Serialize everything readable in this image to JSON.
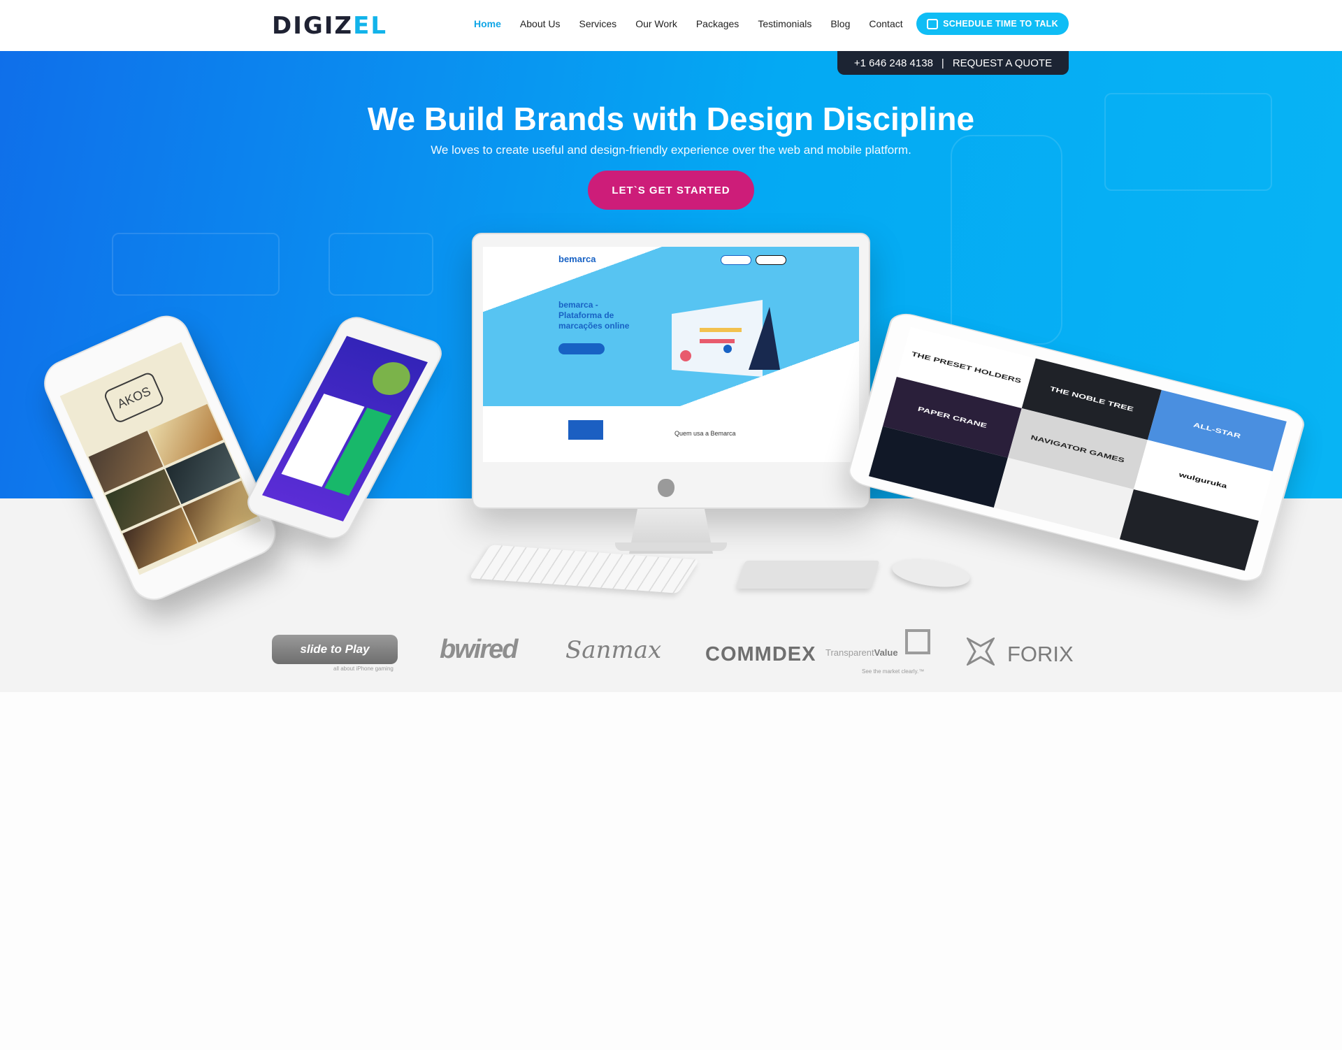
{
  "brand": {
    "name_main": "DIGIZ",
    "name_accent": "EL"
  },
  "nav": {
    "items": [
      {
        "label": "Home",
        "active": true
      },
      {
        "label": "About Us",
        "active": false
      },
      {
        "label": "Services",
        "active": false
      },
      {
        "label": "Our Work",
        "active": false
      },
      {
        "label": "Packages",
        "active": false
      },
      {
        "label": "Testimonials",
        "active": false
      },
      {
        "label": "Blog",
        "active": false
      },
      {
        "label": "Contact",
        "active": false
      }
    ],
    "cta_label": "SCHEDULE TIME TO TALK",
    "cta_icon": "calendar-icon"
  },
  "contact_bar": {
    "phone": "+1 646 248 4138",
    "separator": "|",
    "quote_label": "REQUEST A QUOTE"
  },
  "hero": {
    "title": "We Build Brands with Design Discipline",
    "subtitle": "We loves to create useful and design-friendly experience over the web and mobile platform.",
    "cta_label": "LET`S GET STARTED"
  },
  "imac_screen": {
    "logo": "bemarca",
    "headline": "bemarca - Plataforma de marcações online",
    "section_heading": "Quem usa a Bemarca"
  },
  "iphone_screen": {
    "logo": "AKOS"
  },
  "ipad_logos": [
    "THE PRESET HOLDERS",
    "THE NOBLE TREE",
    "ALL-STAR",
    "PAPER CRANE",
    "NAVIGATOR GAMES",
    "wulguruka"
  ],
  "client_logos": {
    "slide_to_play": "slide to Play",
    "slide_to_play_sub": "all about iPhone gaming",
    "bwired": "bwired",
    "sanmax": "Sanmax",
    "commdex": "COMMDEX",
    "transparent_value_a": "Transparent",
    "transparent_value_b": "Value",
    "transparent_value_sub": "See the market clearly.™",
    "forix": "FORIX"
  },
  "colors": {
    "accent": "#0fbdf5",
    "hero_blue": "#0a8ff0",
    "cta_magenta": "#cd1d79",
    "dark": "#1c2433"
  }
}
